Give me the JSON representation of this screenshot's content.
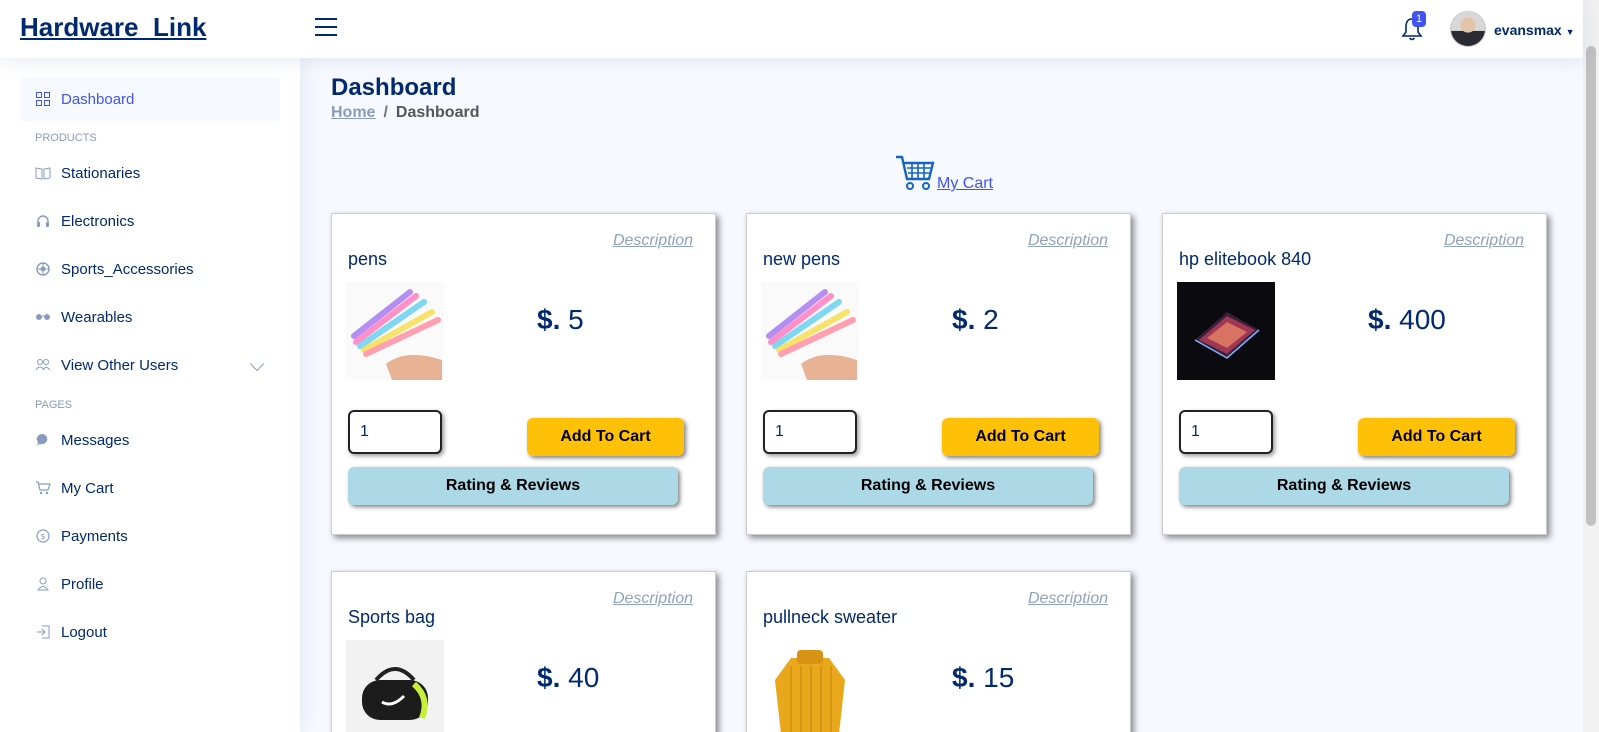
{
  "header": {
    "logo": "Hardware_Link",
    "notification_count": "1",
    "user_name": "evansmax",
    "icons": [
      "menu-icon",
      "bell-icon",
      "caret-down-icon"
    ]
  },
  "sidebar": {
    "dashboard": "Dashboard",
    "products_heading": "PRODUCTS",
    "items": [
      {
        "label": "Stationaries",
        "icon": "book-icon"
      },
      {
        "label": "Electronics",
        "icon": "headset-icon"
      },
      {
        "label": "Sports_Accessories",
        "icon": "ball-icon"
      },
      {
        "label": "Wearables",
        "icon": "glasses-icon"
      },
      {
        "label": "View Other Users",
        "icon": "users-icon"
      }
    ],
    "pages_heading": "PAGES",
    "pages": [
      {
        "label": "Messages",
        "icon": "chat-icon"
      },
      {
        "label": "My Cart",
        "icon": "cart-icon"
      },
      {
        "label": "Payments",
        "icon": "dollar-icon"
      },
      {
        "label": "Profile",
        "icon": "person-icon"
      },
      {
        "label": "Logout",
        "icon": "logout-icon"
      }
    ]
  },
  "main": {
    "title": "Dashboard",
    "breadcrumb_home": "Home",
    "breadcrumb_sep": "/",
    "breadcrumb_current": "Dashboard",
    "cart_link": "My Cart",
    "products": [
      {
        "name": "pens",
        "price_symbol": "$.",
        "price": "5",
        "description": "Description",
        "qty": "1",
        "add_label": "Add To Cart",
        "rate_label": "Rating & Reviews",
        "image": "pens-image"
      },
      {
        "name": "new pens",
        "price_symbol": "$.",
        "price": "2",
        "description": "Description",
        "qty": "1",
        "add_label": "Add To Cart",
        "rate_label": "Rating & Reviews",
        "image": "pens-image"
      },
      {
        "name": "hp elitebook 840",
        "price_symbol": "$.",
        "price": "400",
        "description": "Description",
        "qty": "1",
        "add_label": "Add To Cart",
        "rate_label": "Rating & Reviews",
        "image": "laptop-image"
      },
      {
        "name": "Sports bag",
        "price_symbol": "$.",
        "price": "40",
        "description": "Description",
        "image": "bag-image"
      },
      {
        "name": "pullneck sweater",
        "price_symbol": "$.",
        "price": "15",
        "description": "Description",
        "image": "sweater-image"
      }
    ]
  },
  "colors": {
    "brand": "#012970",
    "accent": "#4154f1",
    "add_button": "#ffc107",
    "rating_button": "#add8e6"
  }
}
